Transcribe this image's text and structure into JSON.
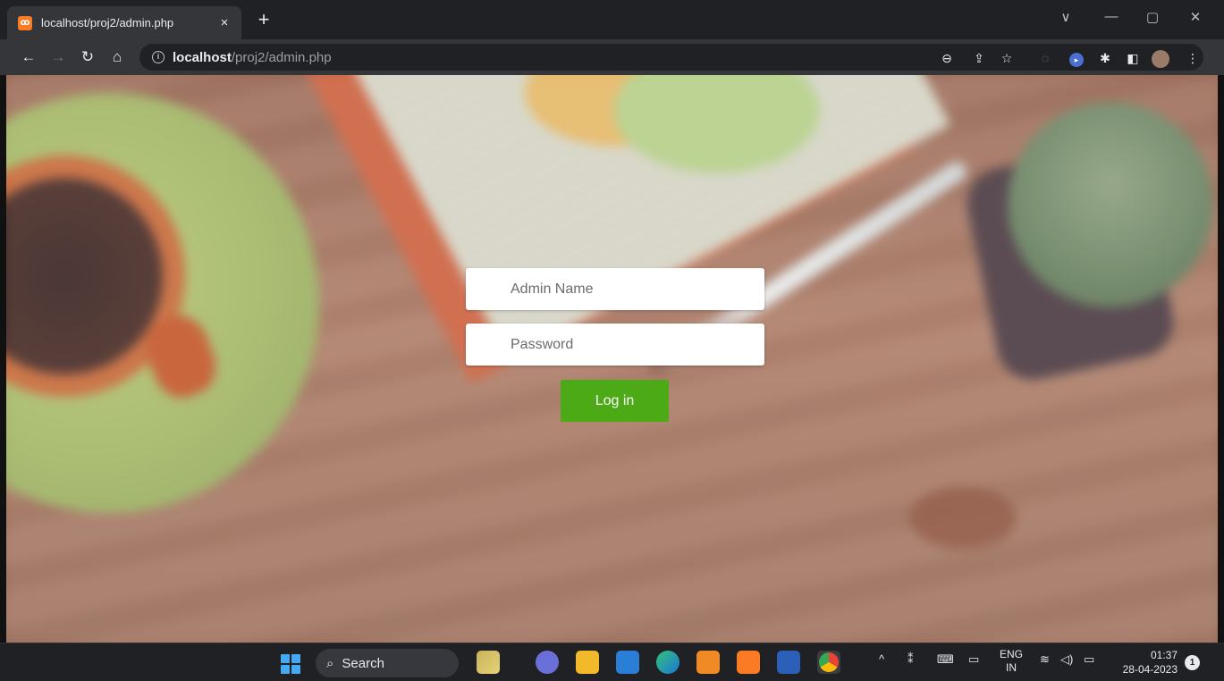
{
  "browser": {
    "tab_title": "localhost/proj2/admin.php",
    "tab_favicon": "xampp-icon",
    "tab_close": "×",
    "new_tab": "+",
    "url_host": "localhost",
    "url_path": "/proj2/admin.php",
    "window_controls": [
      "∨",
      "—",
      "▢",
      "✕"
    ]
  },
  "login": {
    "admin_name_placeholder": "Admin Name",
    "password_placeholder": "Password",
    "login_label": "Log in",
    "button_color": "#4caa17"
  },
  "taskbar": {
    "search_label": "Search",
    "language_top": "ENG",
    "language_bottom": "IN",
    "time": "01:37",
    "date": "28-04-2023",
    "notification_count": "1"
  }
}
